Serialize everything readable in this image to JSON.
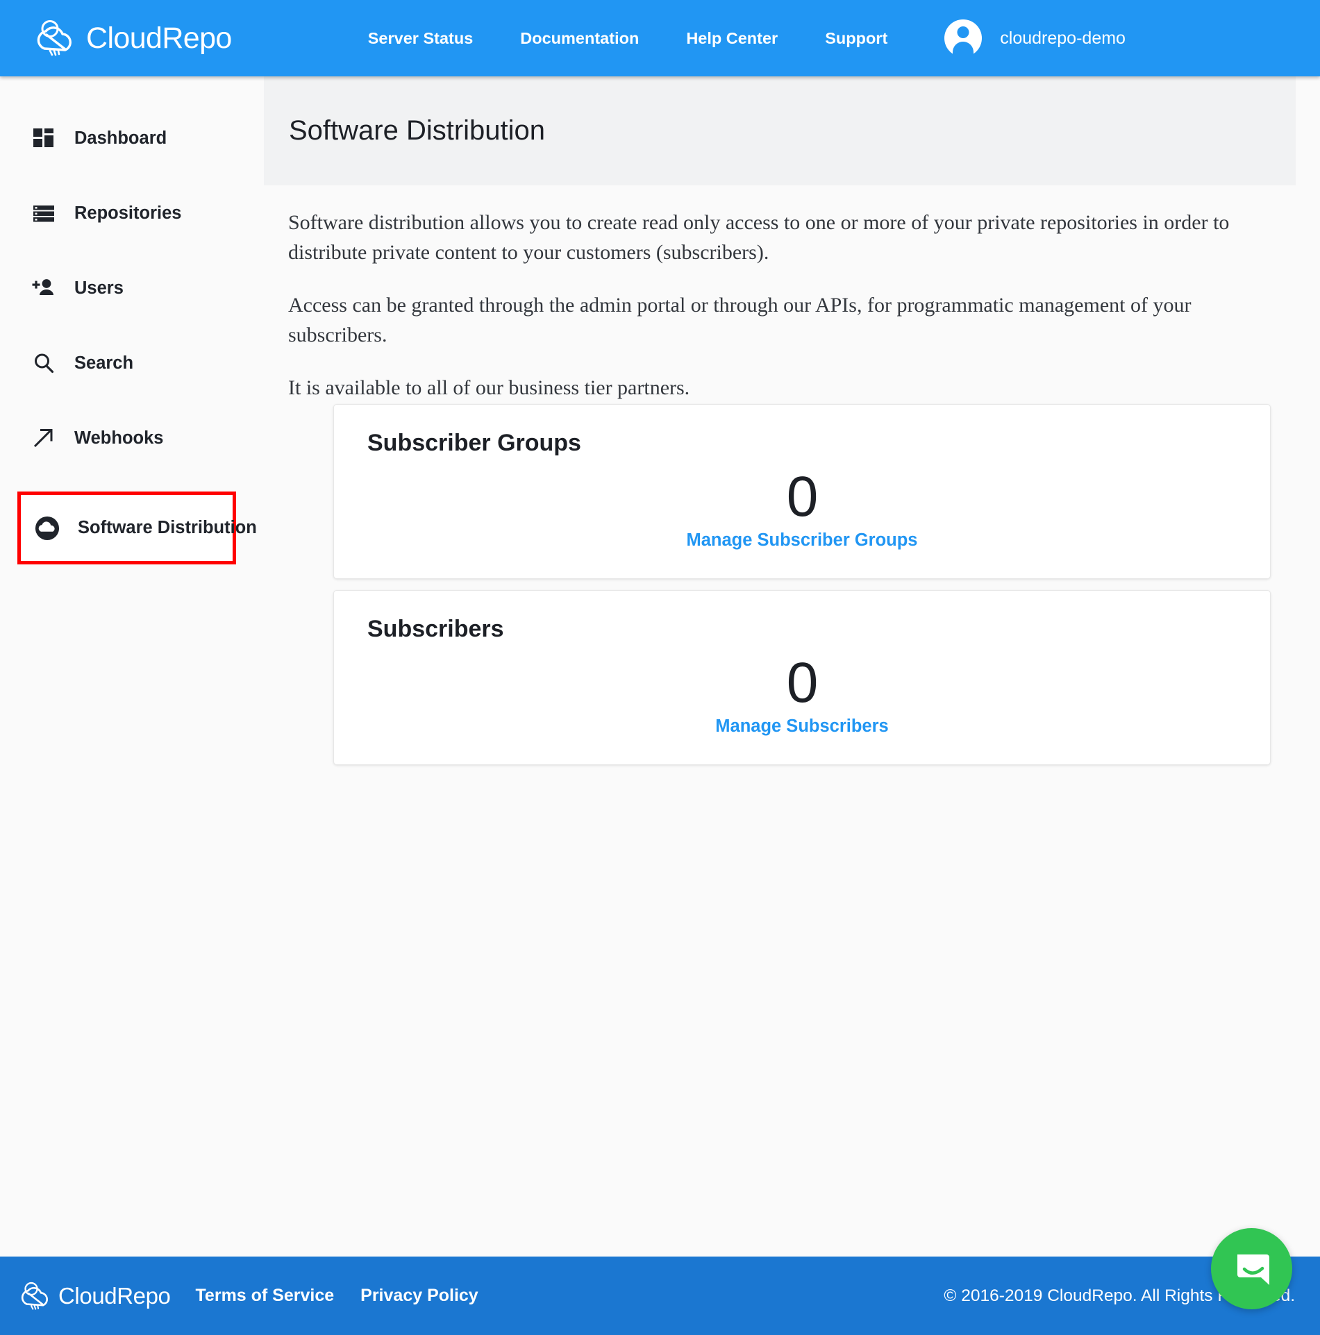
{
  "header": {
    "brand": "CloudRepo",
    "nav_links": [
      {
        "label": "Server Status",
        "name": "nav-link-server-status"
      },
      {
        "label": "Documentation",
        "name": "nav-link-documentation"
      },
      {
        "label": "Help Center",
        "name": "nav-link-help-center"
      },
      {
        "label": "Support",
        "name": "nav-link-support"
      }
    ],
    "user": "cloudrepo-demo",
    "background_color": "#2196f3"
  },
  "sidebar": {
    "items": [
      {
        "label": "Dashboard",
        "icon": "dashboard-grid-icon",
        "active": false
      },
      {
        "label": "Repositories",
        "icon": "server-stack-icon",
        "active": false
      },
      {
        "label": "Users",
        "icon": "add-user-icon",
        "active": false
      },
      {
        "label": "Search",
        "icon": "search-icon",
        "active": false
      },
      {
        "label": "Webhooks",
        "icon": "arrow-up-right-icon",
        "active": false
      },
      {
        "label": "Software Distribution",
        "icon": "cloud-icon",
        "active": true
      }
    ],
    "highlight_color": "#ff0000"
  },
  "main": {
    "page_title": "Software Distribution",
    "paragraphs": [
      "Software distribution allows you to create read only access to one or more of your private repositories in order to distribute private content to your customers (subscribers).",
      "Access can be granted through the admin portal or through our APIs, for programmatic management of your subscribers.",
      "It is available to all of our business tier partners."
    ],
    "cards": [
      {
        "title": "Subscriber Groups",
        "count": "0",
        "link_label": "Manage Subscriber Groups"
      },
      {
        "title": "Subscribers",
        "count": "0",
        "link_label": "Manage Subscribers"
      }
    ],
    "link_color": "#2196f3"
  },
  "footer": {
    "brand": "CloudRepo",
    "links": [
      {
        "label": "Terms of Service"
      },
      {
        "label": "Privacy Policy"
      }
    ],
    "copyright": "© 2016-2019 CloudRepo. All Rights Reserved.",
    "background_color": "#1b77d1"
  },
  "chat": {
    "icon": "chat-bubble-icon",
    "color": "#31c553"
  }
}
